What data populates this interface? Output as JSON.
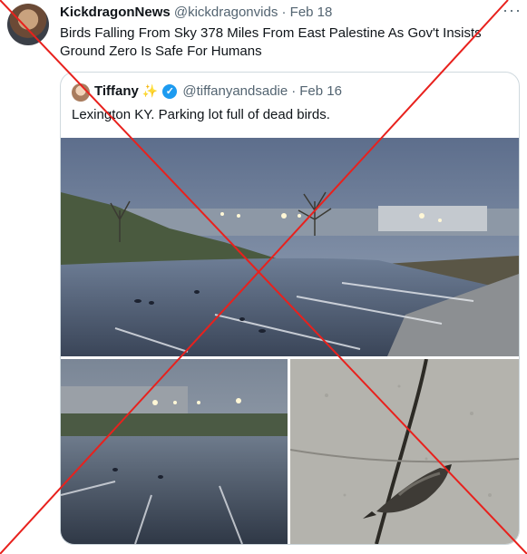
{
  "tweet": {
    "author_name": "KickdragonNews",
    "handle": "@kickdragonvids",
    "separator": "·",
    "date": "Feb 18",
    "more_icon": "more-icon",
    "text": "Birds Falling From Sky 378 Miles From East Palestine As Gov't Insists Ground Zero Is Safe For Humans"
  },
  "quote": {
    "author_name": "Tiffany",
    "sparkle_emoji": "✨",
    "verified_icon": "verified-badge-icon",
    "handle": "@tiffanyandsadie",
    "separator": "·",
    "date": "Feb 16",
    "text": "Lexington KY. Parking lot full of dead birds."
  },
  "overlay": {
    "cross_color": "#e8211d"
  }
}
